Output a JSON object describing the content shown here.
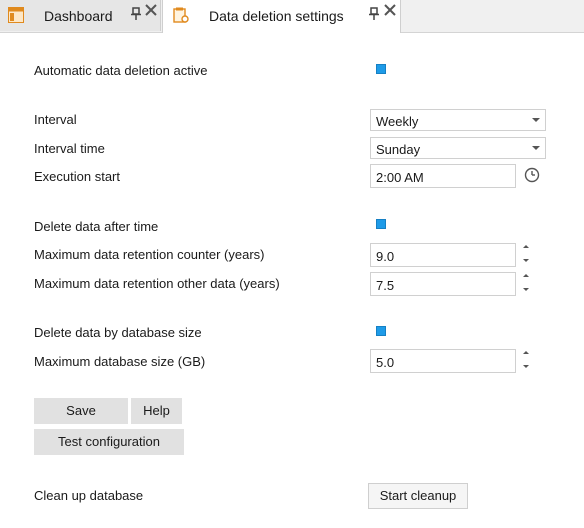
{
  "tabs": [
    {
      "label": "Dashboard",
      "icon": "dashboard-icon",
      "active": false
    },
    {
      "label": "Data deletion settings",
      "icon": "settings-document-icon",
      "active": true
    }
  ],
  "form": {
    "auto_delete_label": "Automatic data deletion active",
    "auto_delete_checked": true,
    "interval_label": "Interval",
    "interval_value": "Weekly",
    "interval_time_label": "Interval time",
    "interval_time_value": "Sunday",
    "execution_start_label": "Execution start",
    "execution_start_value": "2:00 AM",
    "delete_after_time_label": "Delete data after time",
    "delete_after_time_checked": true,
    "retention_counter_label": "Maximum data retention counter (years)",
    "retention_counter_value": "9.0",
    "retention_other_label": "Maximum data retention other data (years)",
    "retention_other_value": "7.5",
    "delete_by_size_label": "Delete data by database size",
    "delete_by_size_checked": true,
    "max_db_size_label": "Maximum database size (GB)",
    "max_db_size_value": "5.0"
  },
  "buttons": {
    "save": "Save",
    "help": "Help",
    "test_configuration": "Test configuration",
    "start_cleanup": "Start cleanup"
  },
  "cleanup": {
    "label": "Clean up database"
  },
  "colors": {
    "accent": "#1e9be8",
    "button_bg": "#e1e1e1"
  }
}
